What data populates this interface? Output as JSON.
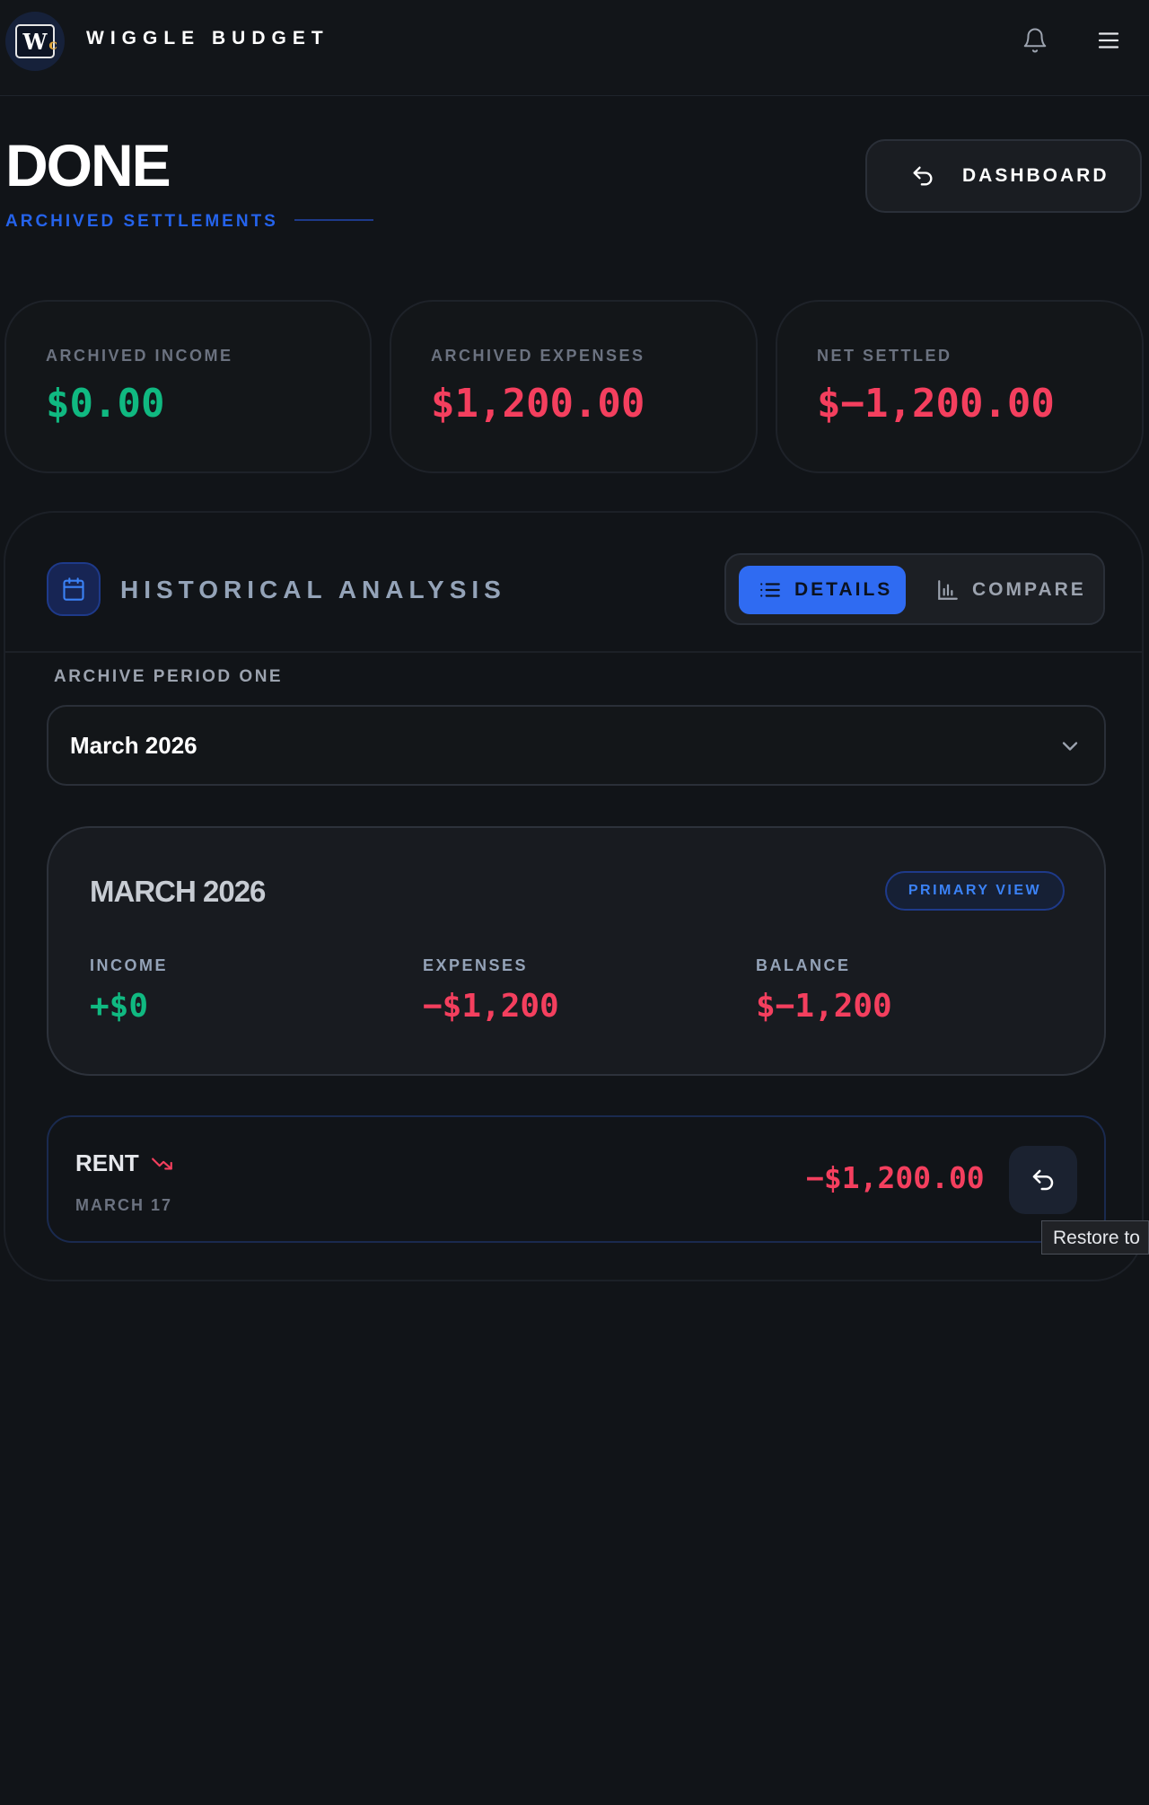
{
  "app": {
    "brand": "WIGGLE BUDGET",
    "logo_letter": "W",
    "logo_accent": "c"
  },
  "header": {
    "title": "DONE",
    "subtitle": "ARCHIVED SETTLEMENTS",
    "dashboard_label": "DASHBOARD"
  },
  "stats": [
    {
      "label": "ARCHIVED INCOME",
      "value": "$0.00",
      "tone": "#10b981"
    },
    {
      "label": "ARCHIVED EXPENSES",
      "value": "$1,200.00",
      "tone": "#f43f5e"
    },
    {
      "label": "NET SETTLED",
      "value": "$−1,200.00",
      "tone": "#f43f5e"
    }
  ],
  "analysis": {
    "title": "HISTORICAL ANALYSIS",
    "tabs": {
      "details": "DETAILS",
      "compare": "COMPARE",
      "active": "details"
    },
    "period_label": "ARCHIVE PERIOD ONE",
    "period_value": "March 2026",
    "summary": {
      "title": "MARCH 2026",
      "badge": "PRIMARY VIEW",
      "income_label": "INCOME",
      "income_value": "+$0",
      "expenses_label": "EXPENSES",
      "expenses_value": "−$1,200",
      "balance_label": "BALANCE",
      "balance_value": "$−1,200"
    },
    "transactions": [
      {
        "name": "RENT",
        "date": "MARCH 17",
        "amount": "−$1,200.00",
        "trend": "trending-down-icon"
      }
    ],
    "tooltip": "Restore to"
  },
  "colors": {
    "accent": "#2f6bf2",
    "positive": "#10b981",
    "negative": "#f43f5e",
    "background": "#111418"
  },
  "icons": {
    "notifications": "bell-icon",
    "menu": "hamburger-menu-icon",
    "dashboard": "undo-arrow-icon",
    "calendar": "calendar-icon",
    "details": "list-icon",
    "compare": "bar-chart-icon",
    "dropdown": "chevron-down-icon",
    "restore": "undo-arrow-icon"
  }
}
